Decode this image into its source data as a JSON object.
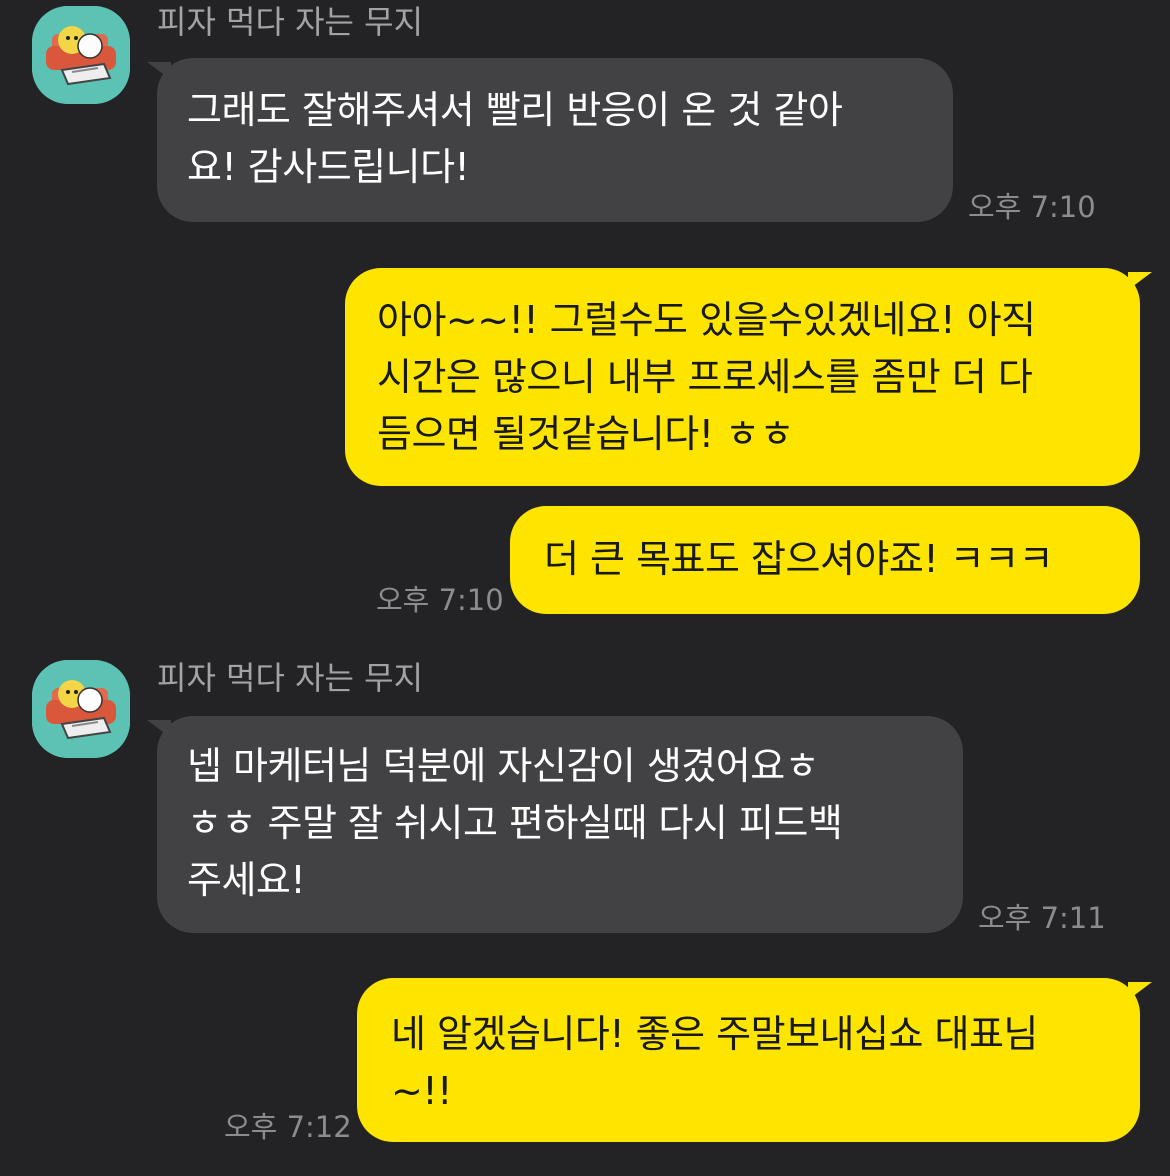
{
  "messages": [
    {
      "sender": "피자 먹다 자는 무지",
      "text": "그래도 잘해주셔서 빨리 반응이 온 것 같아\n요! 감사드립니다!",
      "time": "오후 7:10",
      "direction": "incoming"
    },
    {
      "text": "아아~~!! 그럴수도 있을수있겠네요! 아직\n시간은 많으니 내부 프로세스를 좀만 더 다\n듬으면 될것같습니다! ㅎㅎ",
      "direction": "outgoing"
    },
    {
      "text": "더 큰 목표도 잡으셔야죠! ㅋㅋㅋ",
      "time": "오후 7:10",
      "direction": "outgoing"
    },
    {
      "sender": "피자 먹다 자는 무지",
      "text": "넵 마케터님 덕분에 자신감이 생겼어요ㅎ\nㅎㅎ 주말 잘 쉬시고 편하실때 다시 피드백\n주세요!",
      "time": "오후 7:11",
      "direction": "incoming"
    },
    {
      "text": "네 알겠습니다! 좋은 주말보내십쇼 대표님\n~!!",
      "time": "오후 7:12",
      "direction": "outgoing"
    }
  ],
  "avatar_icon": "muzi-character-icon",
  "colors": {
    "background": "#232325",
    "incoming_bubble": "#424245",
    "outgoing_bubble": "#fee500",
    "incoming_text": "#ffffff",
    "outgoing_text": "#191919",
    "name_text": "#a3a3a6",
    "time_text": "#8c8c8f"
  }
}
